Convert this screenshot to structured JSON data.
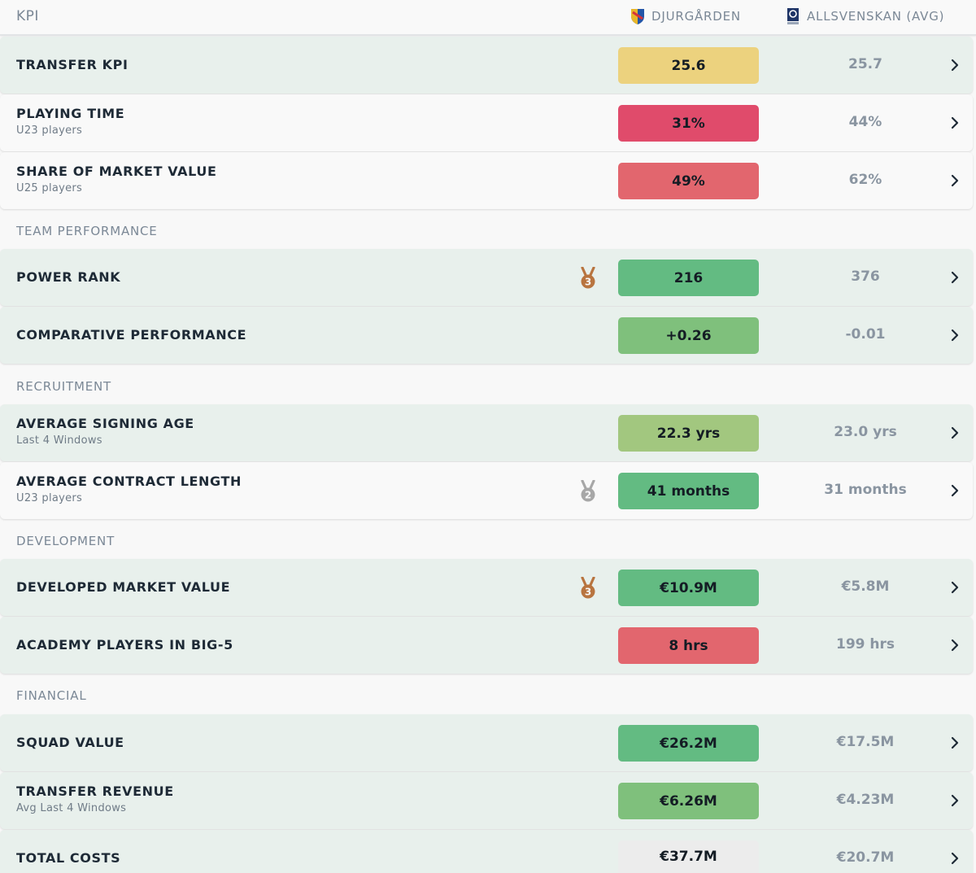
{
  "header": {
    "kpi_label": "KPI",
    "team_label": "DJURGÅRDEN",
    "league_label": "ALLSVENSKAN (AVG)"
  },
  "sections": {
    "team_performance": "TEAM PERFORMANCE",
    "recruitment": "RECRUITMENT",
    "development": "DEVELOPMENT",
    "financial": "FINANCIAL"
  },
  "rows": {
    "transfer_kpi": {
      "name": "TRANSFER KPI",
      "value": "25.6",
      "avg": "25.7",
      "color": "#ecd27e"
    },
    "playing_time": {
      "name": "PLAYING TIME",
      "sub": "U23 players",
      "value": "31%",
      "avg": "44%",
      "color": "#e04b6b"
    },
    "share_market_value": {
      "name": "SHARE OF MARKET VALUE",
      "sub": "U25 players",
      "value": "49%",
      "avg": "62%",
      "color": "#e2666e"
    },
    "power_rank": {
      "name": "POWER RANK",
      "value": "216",
      "avg": "376",
      "color": "#63bb82",
      "medal": "bronze-medal-3-icon"
    },
    "comparative_performance": {
      "name": "COMPARATIVE PERFORMANCE",
      "value": "+0.26",
      "avg": "-0.01",
      "color": "#7fc07c"
    },
    "avg_signing_age": {
      "name": "AVERAGE SIGNING AGE",
      "sub": "Last 4 Windows",
      "value": "22.3 yrs",
      "avg": "23.0 yrs",
      "color": "#a2c77f"
    },
    "avg_contract_length": {
      "name": "AVERAGE CONTRACT LENGTH",
      "sub": "U23 players",
      "value": "41 months",
      "avg": "31 months",
      "color": "#63bb82",
      "medal": "silver-medal-2-icon"
    },
    "developed_market_value": {
      "name": "DEVELOPED MARKET VALUE",
      "value": "€10.9M",
      "avg": "€5.8M",
      "color": "#63bb82",
      "medal": "bronze-medal-3-icon"
    },
    "academy_players_big5": {
      "name": "ACADEMY PLAYERS IN BIG-5",
      "value": "8 hrs",
      "avg": "199 hrs",
      "color": "#e2666e"
    },
    "squad_value": {
      "name": "SQUAD VALUE",
      "value": "€26.2M",
      "avg": "€17.5M",
      "color": "#63bb82"
    },
    "transfer_revenue": {
      "name": "TRANSFER REVENUE",
      "sub": "Avg Last 4 Windows",
      "value": "€6.26M",
      "avg": "€4.23M",
      "color": "#7fc07c"
    },
    "total_costs": {
      "name": "TOTAL COSTS",
      "value": "€37.7M",
      "avg": "€20.7M",
      "color": "#ececec"
    }
  }
}
